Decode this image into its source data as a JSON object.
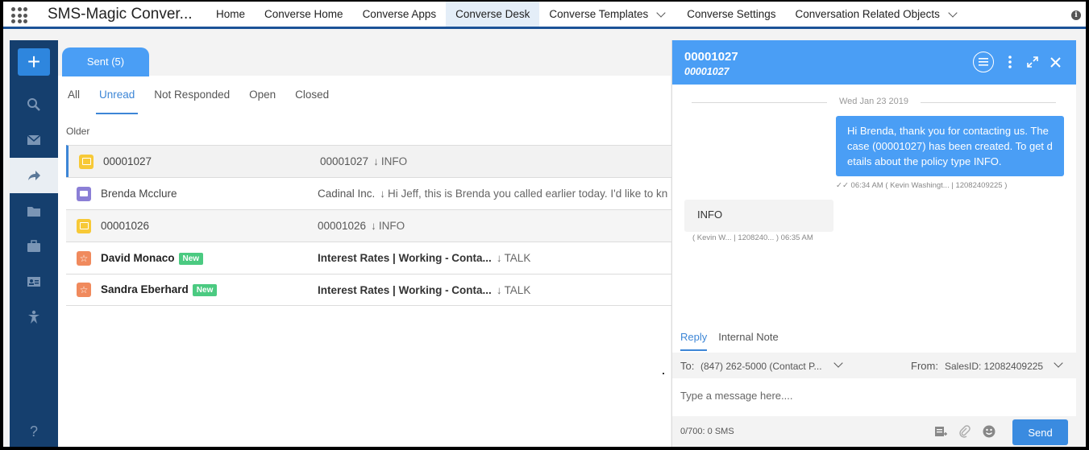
{
  "nav": {
    "app_name": "SMS-Magic Conver...",
    "items": [
      {
        "label": "Home",
        "has_menu": false
      },
      {
        "label": "Converse Home",
        "has_menu": false
      },
      {
        "label": "Converse Apps",
        "has_menu": false
      },
      {
        "label": "Converse Desk",
        "has_menu": false,
        "active": true
      },
      {
        "label": "Converse Templates",
        "has_menu": true
      },
      {
        "label": "Converse Settings",
        "has_menu": false
      },
      {
        "label": "Conversation Related Objects",
        "has_menu": true
      }
    ],
    "info_glyph": "i"
  },
  "rail": {
    "new_label": "+",
    "help_label": "?",
    "icons": [
      "search-icon",
      "mail-icon",
      "share-icon",
      "folder-icon",
      "briefcase-icon",
      "contact-card-icon",
      "person-icon"
    ],
    "active_index": 2
  },
  "list": {
    "sent_tab": "Sent (5)",
    "filters": [
      "All",
      "Unread",
      "Not Responded",
      "Open",
      "Closed"
    ],
    "active_filter": 1,
    "group_label": "Older",
    "rows": [
      {
        "icon": "case",
        "name": "00001027",
        "is_new": false,
        "subject": "00001027",
        "keyword": "INFO",
        "bold": false,
        "selected": true
      },
      {
        "icon": "contact",
        "name": "Brenda Mcclure",
        "is_new": false,
        "subject": "Cadinal Inc.",
        "keyword": "Hi Jeff, this is Brenda you called earlier today. I'd like to kn",
        "bold": false
      },
      {
        "icon": "case",
        "name": "00001026",
        "is_new": false,
        "subject": "00001026",
        "keyword": "INFO",
        "bold": false
      },
      {
        "icon": "lead",
        "name": "David Monaco",
        "is_new": true,
        "subject": "Interest Rates | Working - Conta...",
        "keyword": "TALK",
        "bold": true
      },
      {
        "icon": "lead",
        "name": "Sandra Eberhard",
        "is_new": true,
        "subject": "Interest Rates | Working - Conta...",
        "keyword": "TALK",
        "bold": true
      }
    ],
    "new_badge": "New",
    "arrow_glyph": "↓"
  },
  "conversation": {
    "title": "00001027",
    "subtitle": "00001027",
    "date": "Wed Jan 23 2019",
    "outgoing": {
      "text": "Hi Brenda, thank you for contacting us. The case (00001027) has been created. To get details about the policy type INFO.",
      "meta": "✓✓ 06:34 AM ( Kevin Washingt... | 12082409225 )"
    },
    "incoming": {
      "text": "INFO",
      "meta": "( Kevin W... | 1208240... ) 06:35 AM"
    },
    "reply_tabs": [
      "Reply",
      "Internal Note"
    ],
    "to_label": "To:",
    "to_value": "(847) 262-5000 (Contact P...",
    "from_label": "From:",
    "from_value": "SalesID: 12082409225",
    "placeholder": "Type a message here....",
    "count": "0/700: 0 SMS",
    "send_label": "Send"
  },
  "colors": {
    "brand_blue": "#4a9ef5",
    "rail": "#153f6e",
    "nav_underline": "#1b5297",
    "new_badge": "#4bca81"
  }
}
